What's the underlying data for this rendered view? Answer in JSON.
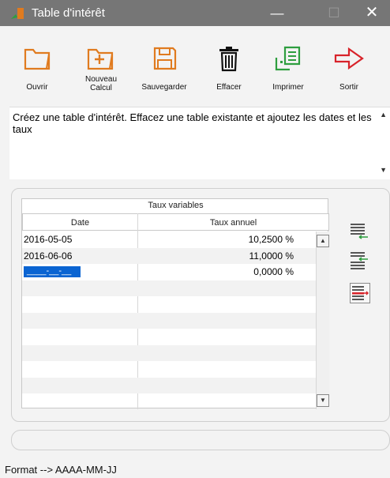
{
  "window": {
    "title": "Table d'intérêt",
    "minimize": "—",
    "maximize": "☐",
    "close": "✕"
  },
  "toolbar": {
    "open": "Ouvrir",
    "new_line1": "Nouveau",
    "new_line2": "Calcul",
    "save": "Sauvegarder",
    "delete": "Effacer",
    "print": "Imprimer",
    "exit": "Sortir"
  },
  "description": "Créez une table d'intérêt. Effacez une table existante et ajoutez les dates et les taux",
  "table": {
    "group_header": "Taux variables",
    "columns": [
      "Date",
      "Taux annuel"
    ],
    "rows": [
      {
        "date": "2016-05-05",
        "rate": "10,2500 %"
      },
      {
        "date": "2016-06-06",
        "rate": "11,0000 %"
      },
      {
        "date": "____-__-__",
        "rate": "0,0000 %"
      }
    ]
  },
  "status": {
    "format_hint": "Format --> AAAA-MM-JJ"
  },
  "colors": {
    "titlebar": "#767676",
    "accent_orange": "#e07b1f",
    "accent_green": "#2e9e3f",
    "accent_red": "#d8232a",
    "selection": "#0a64d2"
  }
}
